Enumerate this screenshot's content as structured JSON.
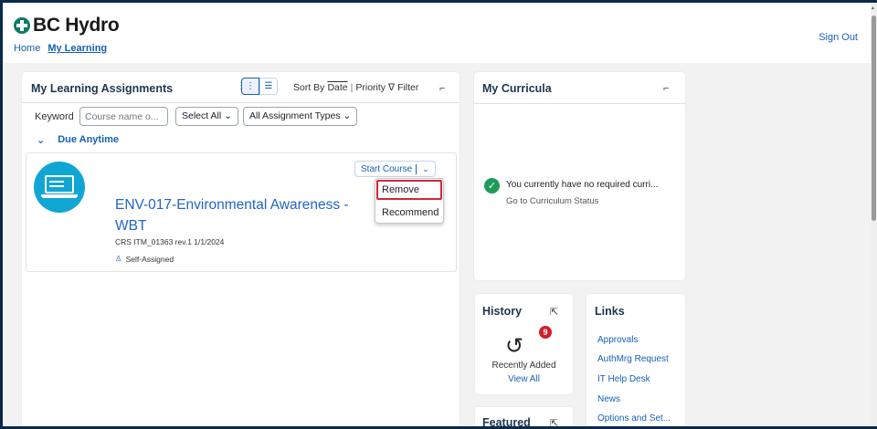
{
  "header": {
    "brand": "BC Hydro",
    "nav": [
      {
        "label": "Home",
        "active": false
      },
      {
        "label": "My Learning",
        "active": true
      }
    ],
    "sign_out": "Sign Out"
  },
  "assignments": {
    "title": "My Learning Assignments",
    "sort_by": "Sort By",
    "sort_date": "Date",
    "sort_sep": "|",
    "sort_priority": "Priority",
    "filter": "Filter",
    "keyword_label": "Keyword",
    "keyword_placeholder": "Course name o...",
    "select_all": "Select All",
    "assignment_types": "All Assignment Types",
    "due_group": "Due Anytime",
    "course": {
      "title": "ENV-017-Environmental Awareness - WBT",
      "meta": "CRS ITM_01363 rev.1 1/1/2024",
      "assigned": "Self-Assigned",
      "start": "Start Course"
    },
    "menu": {
      "remove": "Remove",
      "recommend": "Recommend"
    }
  },
  "curricula": {
    "title": "My Curricula",
    "message": "You currently have no required curri...",
    "link": "Go to Curriculum Status"
  },
  "history": {
    "title": "History",
    "badge": "9",
    "label": "Recently Added",
    "view_all": "View All"
  },
  "featured": {
    "title": "Featured"
  },
  "links": {
    "title": "Links",
    "items": [
      "Approvals",
      "AuthMrg Request",
      "IT Help Desk",
      "News",
      "Options and Set..."
    ]
  },
  "colors": {
    "brand_green": "#0e7a63",
    "link_blue": "#1560b7",
    "course_icon": "#10a6d4",
    "highlight": "#d02838",
    "success": "#1f9b59"
  },
  "icons": [
    "logo-icon",
    "grid-view-icon",
    "list-view-icon",
    "filter-icon",
    "expand-icon",
    "chevron-down-icon",
    "laptop-icon",
    "person-icon",
    "check-circle-icon",
    "history-icon",
    "external-link-icon"
  ]
}
